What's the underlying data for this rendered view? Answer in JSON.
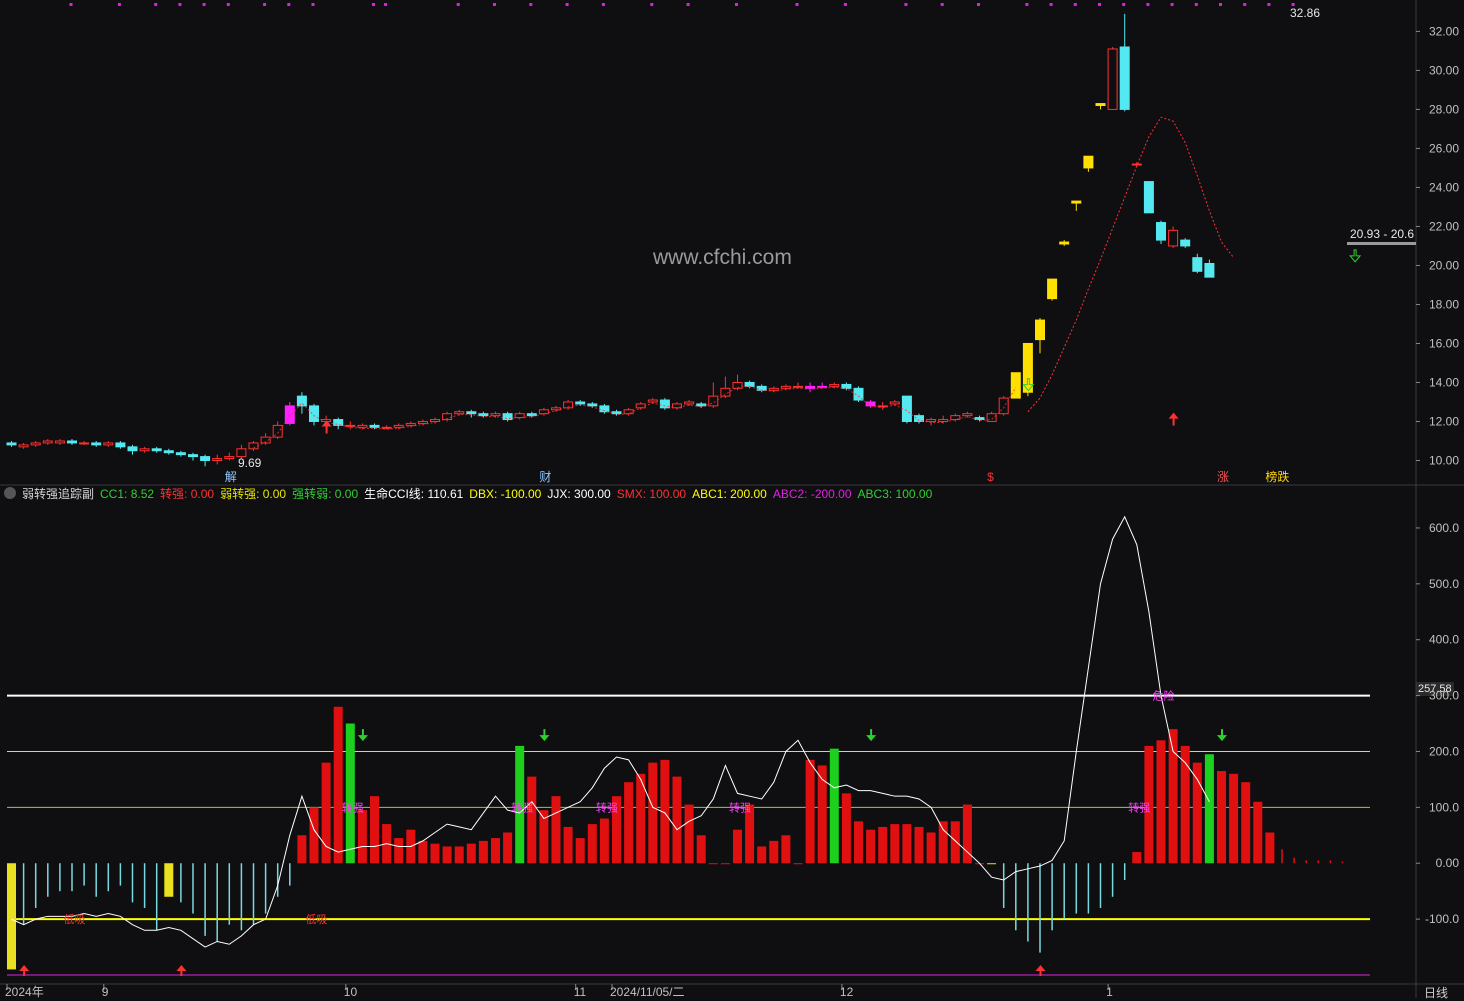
{
  "watermark": "www.cfchi.com",
  "indicator": {
    "name": "弱转强追踪副",
    "items": [
      {
        "label": "CC1: 8.52",
        "color": "#2fd02f"
      },
      {
        "label": "转强: 0.00",
        "color": "#ff3030"
      },
      {
        "label": "弱转强: 0.00",
        "color": "#e6e600"
      },
      {
        "label": "强转弱: 0.00",
        "color": "#2fd02f"
      },
      {
        "label": "生命CCI线: 110.61",
        "color": "#ffffff"
      },
      {
        "label": "DBX: -100.00",
        "color": "#ffff00"
      },
      {
        "label": "JJX: 300.00",
        "color": "#ffffff"
      },
      {
        "label": "SMX: 100.00",
        "color": "#ff3030"
      },
      {
        "label": "ABC1: 200.00",
        "color": "#ffff00"
      },
      {
        "label": "ABC2: -200.00",
        "color": "#e020e0"
      },
      {
        "label": "ABC3: 100.00",
        "color": "#2fd02f"
      }
    ]
  },
  "price_axis": [
    "32.00",
    "30.00",
    "28.00",
    "26.00",
    "24.00",
    "22.00",
    "20.00",
    "18.00",
    "16.00",
    "14.00",
    "12.00",
    "10.00"
  ],
  "indicator_axis": [
    "600.0",
    "500.0",
    "400.0",
    "300.0",
    "200.0",
    "100.0",
    "0.00",
    "-100.0"
  ],
  "current_value": "257.58",
  "x_labels": [
    {
      "text": "2024年",
      "col": 0
    },
    {
      "text": "9",
      "col": 8
    },
    {
      "text": "10",
      "col": 28
    },
    {
      "text": "11",
      "col": 47
    },
    {
      "text": "2024/11/05/二",
      "col": 50
    },
    {
      "text": "12",
      "col": 69
    },
    {
      "text": "1",
      "col": 91
    }
  ],
  "period_label": "日线",
  "price_labels": {
    "high": "32.86",
    "low": "9.69",
    "range": "20.93 - 20.6"
  },
  "event_tags": [
    {
      "text": "解",
      "col": 18,
      "color": "#8ec8ff"
    },
    {
      "text": "财",
      "col": 44,
      "color": "#8ec8ff"
    },
    {
      "text": "$",
      "col": 81,
      "color": "#ff3030"
    },
    {
      "text": "涨",
      "col": 100,
      "color": "#ff5050"
    },
    {
      "text": "榜跌",
      "col": 104,
      "color": "#ffd700"
    }
  ],
  "signal_labels": [
    {
      "text": "低吸",
      "col": 5
    },
    {
      "text": "低吸",
      "col": 25
    },
    {
      "text": "转强",
      "col": 28
    },
    {
      "text": "转强",
      "col": 42
    },
    {
      "text": "转强",
      "col": 49
    },
    {
      "text": "转强",
      "col": 60
    },
    {
      "text": "转强",
      "col": 93
    },
    {
      "text": "危险",
      "col": 95
    }
  ],
  "colors": {
    "up": "#ff3030",
    "down": "#54e8f0",
    "limit_up": "#ffe000",
    "special": "#ff20ff",
    "green_bar": "#1ed01e",
    "cci": "#ffffff"
  },
  "chart_data": [
    {
      "type": "candlestick",
      "title": "",
      "ylim": [
        9.0,
        33.2
      ],
      "candles": [
        [
          10.9,
          10.8,
          11.0,
          10.7
        ],
        [
          10.7,
          10.8,
          10.9,
          10.6
        ],
        [
          10.8,
          10.9,
          11.0,
          10.7
        ],
        [
          10.9,
          11.0,
          11.1,
          10.8
        ],
        [
          10.9,
          11.0,
          11.1,
          10.8
        ],
        [
          11.0,
          10.9,
          11.1,
          10.8
        ],
        [
          10.9,
          10.9,
          11.0,
          10.8
        ],
        [
          10.9,
          10.8,
          11.0,
          10.7
        ],
        [
          10.8,
          10.9,
          11.0,
          10.7
        ],
        [
          10.9,
          10.7,
          11.0,
          10.6
        ],
        [
          10.7,
          10.5,
          10.8,
          10.3
        ],
        [
          10.5,
          10.6,
          10.7,
          10.4
        ],
        [
          10.6,
          10.5,
          10.7,
          10.4
        ],
        [
          10.5,
          10.4,
          10.6,
          10.3
        ],
        [
          10.4,
          10.3,
          10.5,
          10.2
        ],
        [
          10.3,
          10.2,
          10.4,
          10.0
        ],
        [
          10.2,
          10.0,
          10.3,
          9.7
        ],
        [
          10.0,
          10.1,
          10.3,
          9.8
        ],
        [
          10.1,
          10.2,
          10.4,
          10.0
        ],
        [
          10.2,
          10.6,
          10.8,
          10.1
        ],
        [
          10.6,
          10.9,
          11.0,
          10.5
        ],
        [
          10.9,
          11.2,
          11.4,
          10.8
        ],
        [
          11.2,
          11.8,
          12.0,
          11.1
        ],
        [
          11.9,
          12.8,
          13.0,
          11.8
        ],
        [
          13.3,
          12.8,
          13.5,
          12.4
        ],
        [
          12.8,
          12.0,
          12.9,
          11.8
        ],
        [
          12.0,
          12.1,
          12.3,
          11.9
        ],
        [
          12.1,
          11.8,
          12.2,
          11.6
        ],
        [
          11.8,
          11.8,
          12.0,
          11.6
        ],
        [
          11.7,
          11.8,
          11.9,
          11.6
        ],
        [
          11.8,
          11.7,
          11.9,
          11.6
        ],
        [
          11.7,
          11.7,
          11.8,
          11.6
        ],
        [
          11.7,
          11.8,
          11.9,
          11.6
        ],
        [
          11.8,
          11.9,
          12.0,
          11.7
        ],
        [
          11.9,
          12.0,
          12.1,
          11.8
        ],
        [
          12.0,
          12.1,
          12.2,
          11.9
        ],
        [
          12.1,
          12.4,
          12.5,
          12.0
        ],
        [
          12.4,
          12.5,
          12.6,
          12.3
        ],
        [
          12.5,
          12.4,
          12.6,
          12.2
        ],
        [
          12.4,
          12.3,
          12.5,
          12.2
        ],
        [
          12.3,
          12.4,
          12.5,
          12.2
        ],
        [
          12.4,
          12.1,
          12.5,
          12.0
        ],
        [
          12.2,
          12.4,
          12.5,
          12.1
        ],
        [
          12.4,
          12.3,
          12.5,
          12.2
        ],
        [
          12.4,
          12.6,
          12.7,
          12.3
        ],
        [
          12.6,
          12.7,
          12.8,
          12.5
        ],
        [
          12.7,
          13.0,
          13.1,
          12.6
        ],
        [
          13.0,
          12.9,
          13.1,
          12.8
        ],
        [
          12.9,
          12.8,
          13.0,
          12.7
        ],
        [
          12.8,
          12.5,
          12.9,
          12.4
        ],
        [
          12.5,
          12.4,
          12.6,
          12.3
        ],
        [
          12.4,
          12.6,
          12.7,
          12.3
        ],
        [
          12.7,
          12.9,
          13.0,
          12.6
        ],
        [
          13.0,
          13.1,
          13.2,
          12.9
        ],
        [
          13.1,
          12.7,
          13.2,
          12.6
        ],
        [
          12.7,
          12.9,
          13.0,
          12.6
        ],
        [
          12.9,
          13.0,
          13.1,
          12.8
        ],
        [
          12.9,
          12.8,
          13.0,
          12.7
        ],
        [
          12.8,
          13.3,
          14.0,
          12.7
        ],
        [
          13.3,
          13.7,
          14.3,
          13.2
        ],
        [
          13.7,
          14.0,
          14.4,
          13.6
        ],
        [
          14.0,
          13.8,
          14.1,
          13.7
        ],
        [
          13.8,
          13.6,
          13.9,
          13.5
        ],
        [
          13.6,
          13.7,
          13.8,
          13.5
        ],
        [
          13.7,
          13.8,
          13.9,
          13.6
        ],
        [
          13.8,
          13.8,
          14.0,
          13.7
        ],
        [
          13.8,
          13.7,
          14.0,
          13.5
        ],
        [
          13.8,
          13.8,
          14.0,
          13.7
        ],
        [
          13.8,
          13.9,
          14.0,
          13.7
        ],
        [
          13.9,
          13.7,
          14.0,
          13.6
        ],
        [
          13.7,
          13.1,
          13.8,
          13.0
        ],
        [
          13.0,
          12.8,
          13.1,
          12.7
        ],
        [
          12.8,
          12.8,
          13.0,
          12.6
        ],
        [
          12.9,
          13.0,
          13.1,
          12.8
        ],
        [
          13.3,
          12.0,
          13.3,
          11.9
        ],
        [
          12.3,
          12.0,
          12.4,
          11.9
        ],
        [
          12.0,
          12.1,
          12.2,
          11.8
        ],
        [
          12.0,
          12.1,
          12.3,
          11.9
        ],
        [
          12.1,
          12.3,
          12.4,
          12.0
        ],
        [
          12.3,
          12.4,
          12.5,
          12.2
        ],
        [
          12.2,
          12.1,
          12.3,
          12.0
        ],
        [
          12.0,
          12.4,
          12.5,
          12.0
        ],
        [
          12.4,
          13.2,
          13.3,
          12.3
        ]
      ],
      "late_candles": [
        [
          13.2,
          14.5,
          14.5,
          13.2
        ],
        [
          13.5,
          16.0,
          16.0,
          13.3
        ],
        [
          16.2,
          17.2,
          17.3,
          15.5
        ],
        [
          18.3,
          19.3,
          19.3,
          18.2
        ],
        [
          21.1,
          21.2,
          21.3,
          21.0
        ],
        [
          23.2,
          23.3,
          23.3,
          22.8
        ],
        [
          25.0,
          25.6,
          25.6,
          24.8
        ],
        [
          28.2,
          28.3,
          28.3,
          28.0
        ],
        [
          28.0,
          31.1,
          31.2,
          28.0
        ],
        [
          31.2,
          28.0,
          32.9,
          27.9
        ],
        [
          25.2,
          25.2,
          25.3,
          25.1
        ],
        [
          24.3,
          22.7,
          24.3,
          22.7
        ],
        [
          22.2,
          21.3,
          22.3,
          21.1
        ],
        [
          21.0,
          21.8,
          22.0,
          20.9
        ],
        [
          21.3,
          21.0,
          21.4,
          20.9
        ],
        [
          20.4,
          19.7,
          20.6,
          19.6
        ],
        [
          20.1,
          19.4,
          20.3,
          19.4
        ]
      ],
      "limit_up_cols": [
        83,
        84,
        85,
        86,
        87,
        88,
        89,
        90
      ],
      "special_cols": [
        23,
        66,
        67,
        71,
        84
      ],
      "series": [
        {
          "name": "",
          "type": "dashed-line",
          "values_from_col": 84,
          "values": [
            12.5,
            13.2,
            14.4,
            15.8,
            17.2,
            18.8,
            20.3,
            21.9,
            23.5,
            25.1,
            26.6,
            27.6,
            27.4,
            26.3,
            24.6,
            22.8,
            21.2,
            20.4
          ]
        }
      ],
      "volume_marks_top_cols": [
        5,
        9,
        12,
        14,
        16,
        18,
        21,
        23,
        25,
        30,
        31,
        37,
        40,
        43,
        46,
        49,
        53,
        56,
        60,
        65,
        69,
        74,
        77,
        80,
        84,
        86,
        88,
        90,
        92,
        94,
        96,
        98,
        100,
        102,
        104,
        106
      ]
    },
    {
      "type": "bar",
      "title": "",
      "ylim": [
        -200,
        650
      ],
      "reference_lines": [
        {
          "value": 300,
          "color": "#ffffff"
        },
        {
          "value": 200,
          "color": "#e6e600"
        },
        {
          "value": 100,
          "color": "#9acd32"
        },
        {
          "value": -100,
          "color": "#ffff00"
        },
        {
          "value": -200,
          "color": "#e020e0"
        }
      ],
      "bars": [
        -190,
        -110,
        -80,
        -60,
        -50,
        -50,
        -40,
        -60,
        -50,
        -40,
        -70,
        -80,
        -120,
        -60,
        -70,
        -90,
        -130,
        -140,
        -110,
        -120,
        -110,
        -90,
        -60,
        -40,
        50,
        100,
        180,
        280,
        250,
        95,
        120,
        70,
        45,
        60,
        40,
        35,
        30,
        30,
        35,
        40,
        45,
        55,
        210,
        155,
        95,
        120,
        65,
        45,
        70,
        80,
        120,
        145,
        160,
        180,
        185,
        155,
        105,
        50,
        0,
        0,
        60,
        105,
        30,
        40,
        50,
        0,
        185,
        175,
        205,
        125,
        75,
        60,
        65,
        70,
        70,
        65,
        55,
        75,
        75,
        105,
        0,
        0,
        -80,
        -120,
        -140,
        -160,
        -120,
        -100,
        -90,
        -90,
        -80,
        -60,
        -30,
        20,
        210,
        220,
        240,
        210,
        180,
        195,
        165,
        160,
        145,
        110,
        55,
        25,
        10,
        5,
        5,
        5,
        3
      ],
      "green_bar_cols": [
        28,
        42,
        68,
        99
      ],
      "yellow_bar_cols": [
        0,
        13,
        81
      ],
      "cci": [
        -100,
        -110,
        -100,
        -95,
        -95,
        -95,
        -90,
        -95,
        -90,
        -95,
        -110,
        -120,
        -120,
        -115,
        -120,
        -135,
        -150,
        -140,
        -145,
        -130,
        -110,
        -100,
        -40,
        50,
        120,
        60,
        30,
        20,
        25,
        30,
        30,
        35,
        30,
        30,
        40,
        55,
        70,
        65,
        60,
        90,
        120,
        95,
        90,
        110,
        80,
        90,
        100,
        110,
        135,
        170,
        190,
        185,
        150,
        100,
        90,
        60,
        75,
        85,
        115,
        175,
        125,
        120,
        115,
        145,
        200,
        220,
        180,
        150,
        135,
        140,
        130,
        130,
        125,
        120,
        120,
        115,
        100,
        60,
        40,
        20,
        0,
        -25,
        -30,
        -15,
        -10,
        -5,
        5,
        40,
        200,
        350,
        500,
        580,
        620,
        570,
        450,
        300,
        200,
        180,
        150,
        110
      ]
    }
  ]
}
